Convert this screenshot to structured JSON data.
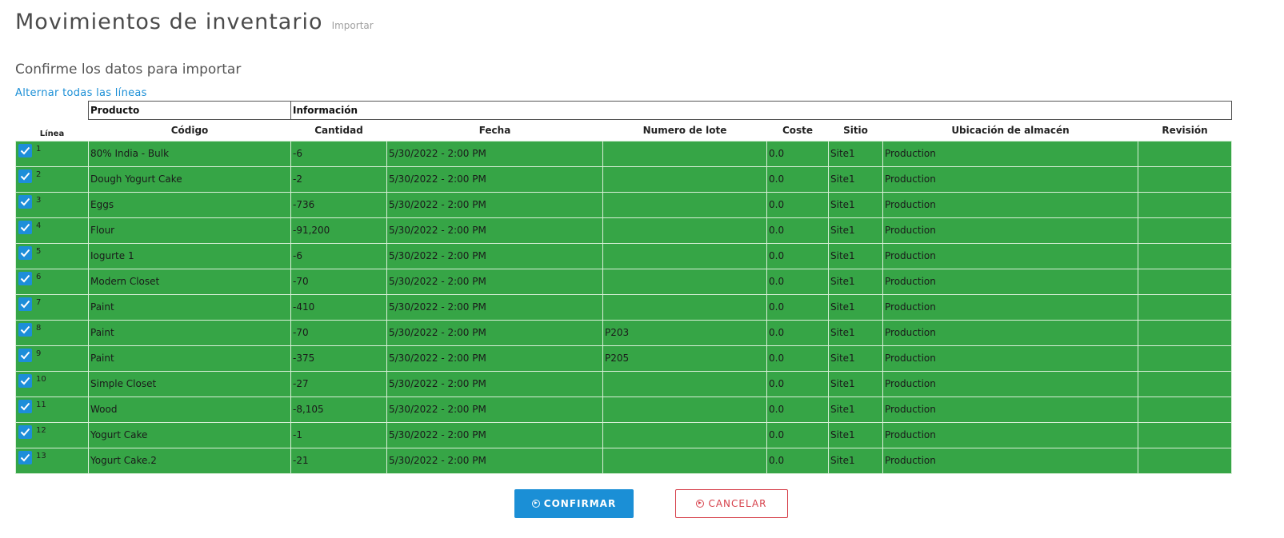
{
  "header": {
    "title": "Movimientos de inventario",
    "subtitle": "Importar"
  },
  "section_title": "Confirme los datos para importar",
  "toggle_all_label": "Alternar todas las líneas",
  "table": {
    "group_headers": {
      "product": "Producto",
      "info": "Información"
    },
    "columns": {
      "line": "Línea",
      "code": "Código",
      "quantity": "Cantidad",
      "date": "Fecha",
      "lot": "Numero de lote",
      "cost": "Coste",
      "site": "Sitio",
      "location": "Ubicación de almacén",
      "revision": "Revisión"
    },
    "rows": [
      {
        "line": "1",
        "checked": true,
        "code": "80% India - Bulk",
        "quantity": "-6",
        "date": "5/30/2022 - 2:00 PM",
        "lot": "",
        "cost": "0.0",
        "site": "Site1",
        "location": "Production",
        "revision": ""
      },
      {
        "line": "2",
        "checked": true,
        "code": "Dough Yogurt Cake",
        "quantity": "-2",
        "date": "5/30/2022 - 2:00 PM",
        "lot": "",
        "cost": "0.0",
        "site": "Site1",
        "location": "Production",
        "revision": ""
      },
      {
        "line": "3",
        "checked": true,
        "code": "Eggs",
        "quantity": "-736",
        "date": "5/30/2022 - 2:00 PM",
        "lot": "",
        "cost": "0.0",
        "site": "Site1",
        "location": "Production",
        "revision": ""
      },
      {
        "line": "4",
        "checked": true,
        "code": "Flour",
        "quantity": "-91,200",
        "date": "5/30/2022 - 2:00 PM",
        "lot": "",
        "cost": "0.0",
        "site": "Site1",
        "location": "Production",
        "revision": ""
      },
      {
        "line": "5",
        "checked": true,
        "code": "Iogurte 1",
        "quantity": "-6",
        "date": "5/30/2022 - 2:00 PM",
        "lot": "",
        "cost": "0.0",
        "site": "Site1",
        "location": "Production",
        "revision": ""
      },
      {
        "line": "6",
        "checked": true,
        "code": "Modern Closet",
        "quantity": "-70",
        "date": "5/30/2022 - 2:00 PM",
        "lot": "",
        "cost": "0.0",
        "site": "Site1",
        "location": "Production",
        "revision": ""
      },
      {
        "line": "7",
        "checked": true,
        "code": "Paint",
        "quantity": "-410",
        "date": "5/30/2022 - 2:00 PM",
        "lot": "",
        "cost": "0.0",
        "site": "Site1",
        "location": "Production",
        "revision": ""
      },
      {
        "line": "8",
        "checked": true,
        "code": "Paint",
        "quantity": "-70",
        "date": "5/30/2022 - 2:00 PM",
        "lot": "P203",
        "cost": "0.0",
        "site": "Site1",
        "location": "Production",
        "revision": ""
      },
      {
        "line": "9",
        "checked": true,
        "code": "Paint",
        "quantity": "-375",
        "date": "5/30/2022 - 2:00 PM",
        "lot": "P205",
        "cost": "0.0",
        "site": "Site1",
        "location": "Production",
        "revision": ""
      },
      {
        "line": "10",
        "checked": true,
        "code": "Simple Closet",
        "quantity": "-27",
        "date": "5/30/2022 - 2:00 PM",
        "lot": "",
        "cost": "0.0",
        "site": "Site1",
        "location": "Production",
        "revision": ""
      },
      {
        "line": "11",
        "checked": true,
        "code": "Wood",
        "quantity": "-8,105",
        "date": "5/30/2022 - 2:00 PM",
        "lot": "",
        "cost": "0.0",
        "site": "Site1",
        "location": "Production",
        "revision": ""
      },
      {
        "line": "12",
        "checked": true,
        "code": "Yogurt Cake",
        "quantity": "-1",
        "date": "5/30/2022 - 2:00 PM",
        "lot": "",
        "cost": "0.0",
        "site": "Site1",
        "location": "Production",
        "revision": ""
      },
      {
        "line": "13",
        "checked": true,
        "code": "Yogurt Cake.2",
        "quantity": "-21",
        "date": "5/30/2022 - 2:00 PM",
        "lot": "",
        "cost": "0.0",
        "site": "Site1",
        "location": "Production",
        "revision": ""
      }
    ]
  },
  "buttons": {
    "confirm": "CONFIRMAR",
    "cancel": "CANCELAR"
  },
  "icons": {
    "checkbox": "check-icon",
    "confirm": "arrow-circle-icon",
    "cancel": "arrow-circle-icon"
  },
  "colors": {
    "row_bg": "#36a546",
    "accent": "#1b8fd6",
    "danger": "#d6404a"
  }
}
